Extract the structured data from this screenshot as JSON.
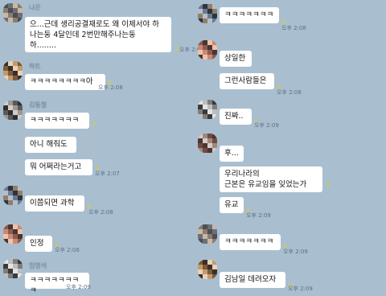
{
  "chat": {
    "left": [
      {
        "sender": "나은",
        "lines": [
          "으...근데 생리공결재로도 왜 이제서야 하",
          "나는둥 4달인데 2번만해주나는둥",
          "하........"
        ],
        "unread": "1",
        "time": "오후 2:08"
      },
      {
        "sender": "하트",
        "lines": [
          "ㅋㅋㅋㅋㅋㅋㅋㅋ아"
        ],
        "unread": "1",
        "time": "오후 2:08"
      },
      {
        "sender": "김동철",
        "lines": [
          "ㅋㅋㅋㅋㅋㅋㅋ"
        ],
        "unread": "1",
        "time": ""
      },
      {
        "sender": "",
        "lines": [
          "아니 해줘도"
        ],
        "unread": "",
        "time": ""
      },
      {
        "sender": "",
        "lines": [
          "뭐 어쩌라는거고"
        ],
        "unread": "1",
        "time": "오후 2:07"
      },
      {
        "sender": "",
        "lines": [
          "이쯤되면 과학"
        ],
        "unread": "1",
        "time": "오후 2:08"
      },
      {
        "sender": "",
        "lines": [
          "인정"
        ],
        "unread": "1",
        "time": "오후 2:08"
      },
      {
        "sender": "임영석",
        "lines": [
          "ㅋㅋㅋㅋㅋㅋㅋㅋ"
        ],
        "unread": "",
        "time": "오후 2:09"
      }
    ],
    "right": [
      {
        "sender": "",
        "lines": [
          "ㅋㅋㅋㅋㅋㅋㅋ"
        ],
        "unread": "1",
        "time": "오후 2:08"
      },
      {
        "sender": "",
        "lines": [
          "상일한"
        ],
        "unread": "",
        "time": ""
      },
      {
        "sender": "",
        "lines": [
          "그런사람들은"
        ],
        "unread": "1",
        "time": "오후 2:08"
      },
      {
        "sender": "",
        "lines": [
          "진짜.."
        ],
        "unread": "1",
        "time": "오후 2:09"
      },
      {
        "sender": "",
        "lines": [
          "후..."
        ],
        "unread": "",
        "time": ""
      },
      {
        "sender": "",
        "lines": [
          "우리나라의",
          "근본은 유교임을 잊었는가"
        ],
        "unread": "1",
        "time": ""
      },
      {
        "sender": "",
        "lines": [
          "유교"
        ],
        "unread": "1",
        "time": "오후 2:09"
      },
      {
        "sender": "",
        "lines": [
          "ㅋㅋㅋㅋㅋㅋㅋ"
        ],
        "unread": "1",
        "time": "오후 2:09"
      },
      {
        "sender": "",
        "lines": [
          "김남일 데려오자"
        ],
        "unread": "1",
        "time": "오후 2:09"
      }
    ]
  },
  "colors": {
    "background": "#a9bfd0",
    "bubble": "#ffffff",
    "unread": "#d9cc34"
  },
  "avatar_icon": "blurred-profile-icon"
}
